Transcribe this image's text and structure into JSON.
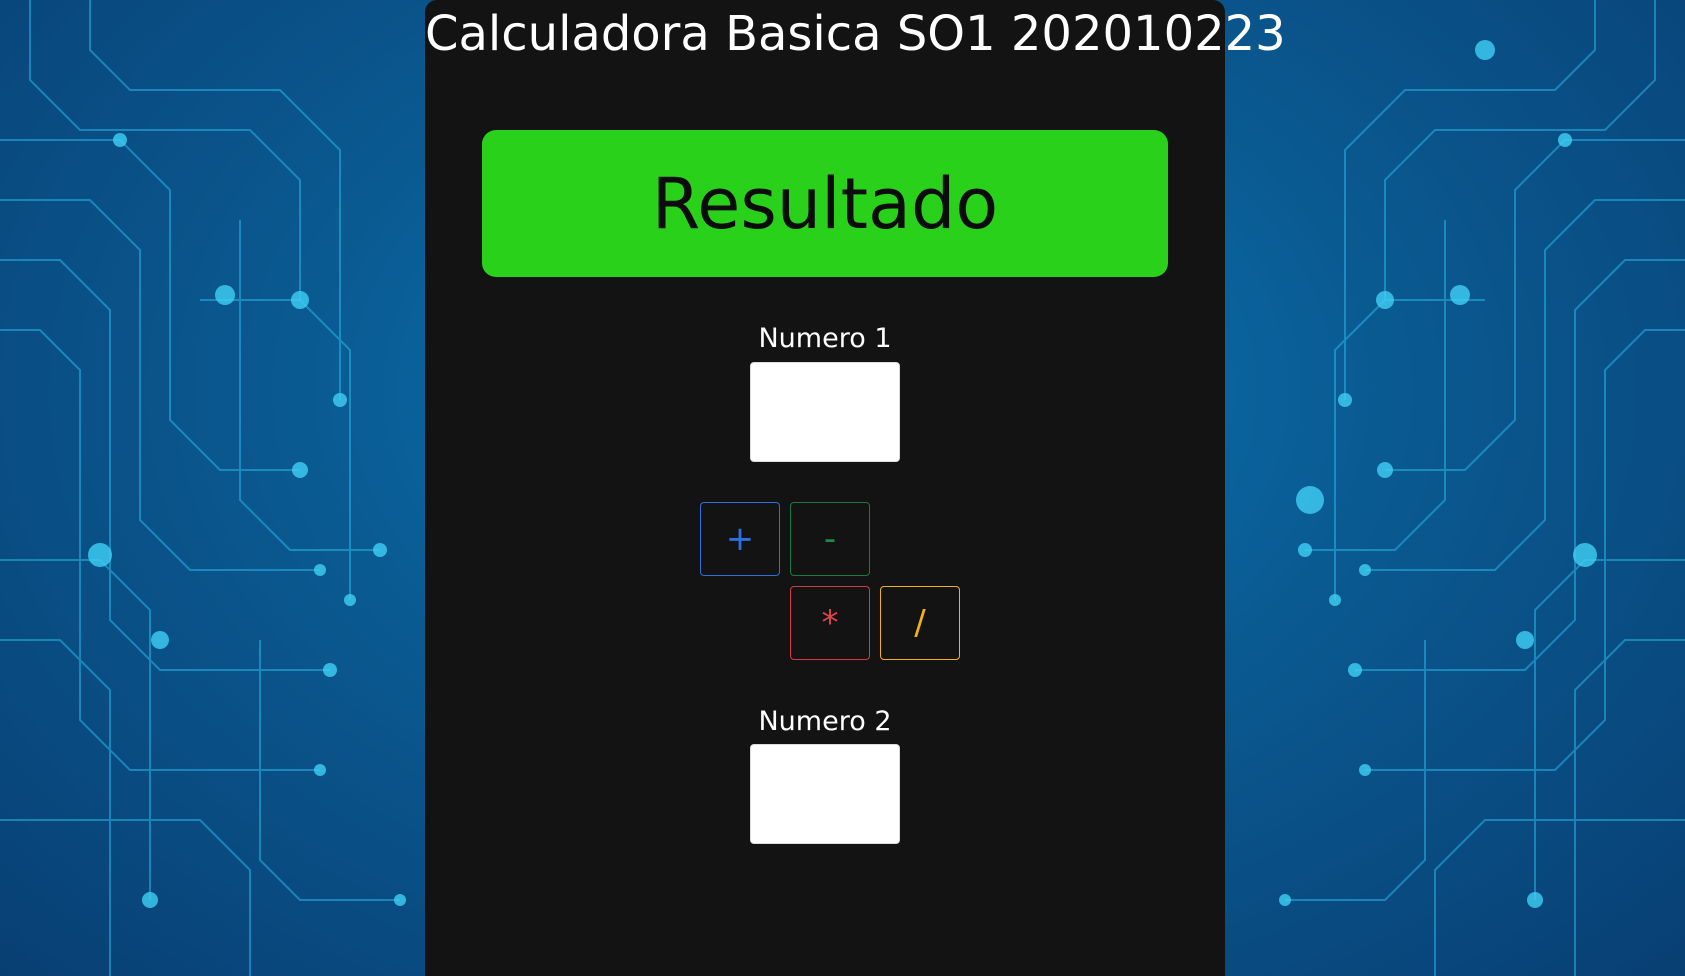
{
  "app": {
    "title": "Calculadora Basica SO1 202010223"
  },
  "result": {
    "label": "Resultado"
  },
  "inputs": {
    "numero1": {
      "label": "Numero 1",
      "value": ""
    },
    "numero2": {
      "label": "Numero 2",
      "value": ""
    }
  },
  "operations": {
    "add": "+",
    "subtract": "-",
    "multiply": "*",
    "divide": "/"
  },
  "colors": {
    "panel_bg": "#131313",
    "result_bg": "#2ad11a",
    "add": "#2b6fe0",
    "subtract": "#1a8a4d",
    "multiply": "#e0454f",
    "divide": "#f2b21a"
  }
}
